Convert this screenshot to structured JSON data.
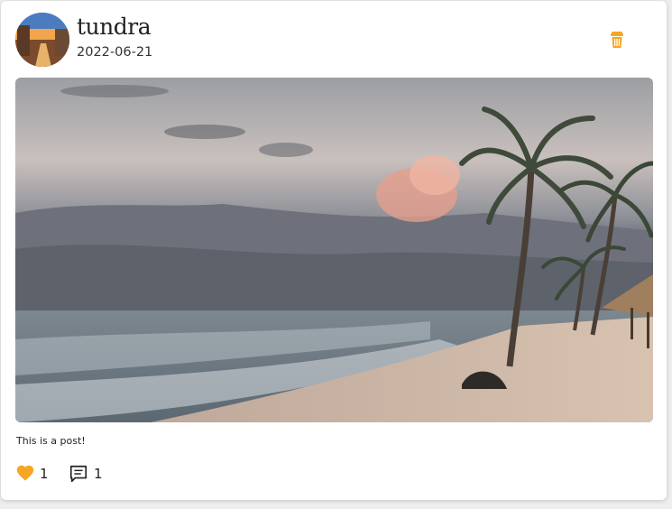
{
  "post": {
    "username": "tundra",
    "date": "2022-06-21",
    "caption": "This is a post!",
    "likes": "1",
    "comments": "1"
  },
  "icons": {
    "delete": "trash-icon",
    "like": "heart-icon",
    "comment": "comment-icon"
  },
  "colors": {
    "accent": "#f5a623",
    "card_bg": "#ffffff",
    "page_bg": "#eeeeee"
  }
}
